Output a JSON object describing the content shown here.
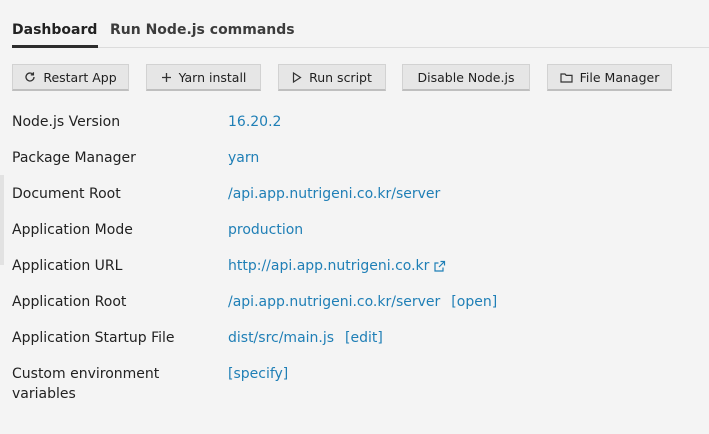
{
  "tabs": {
    "dashboard": "Dashboard",
    "commands": "Run Node.js commands"
  },
  "buttons": {
    "restart": "Restart App",
    "yarn_install": "Yarn install",
    "run_script": "Run script",
    "disable": "Disable Node.js",
    "file_manager": "File Manager"
  },
  "icons": {
    "restart": "refresh-icon",
    "yarn_install": "plus-icon",
    "run_script": "play-icon",
    "file_manager": "folder-icon",
    "app_url": "external-link-icon"
  },
  "info": {
    "node_version": {
      "label": "Node.js Version",
      "value": "16.20.2"
    },
    "package_manager": {
      "label": "Package Manager",
      "value": "yarn"
    },
    "document_root": {
      "label": "Document Root",
      "value": "/api.app.nutrigeni.co.kr/server"
    },
    "app_mode": {
      "label": "Application Mode",
      "value": "production"
    },
    "app_url": {
      "label": "Application URL",
      "value": "http://api.app.nutrigeni.co.kr"
    },
    "app_root": {
      "label": "Application Root",
      "value": "/api.app.nutrigeni.co.kr/server",
      "action": "[open]"
    },
    "startup_file": {
      "label": "Application Startup File",
      "value": "dist/src/main.js",
      "action": "[edit]"
    },
    "env_vars": {
      "label": "Custom environment variables",
      "action": "[specify]"
    }
  },
  "colors": {
    "link": "#1f7fb6",
    "background": "#f4f4f4",
    "button": "#e6e6e6"
  }
}
